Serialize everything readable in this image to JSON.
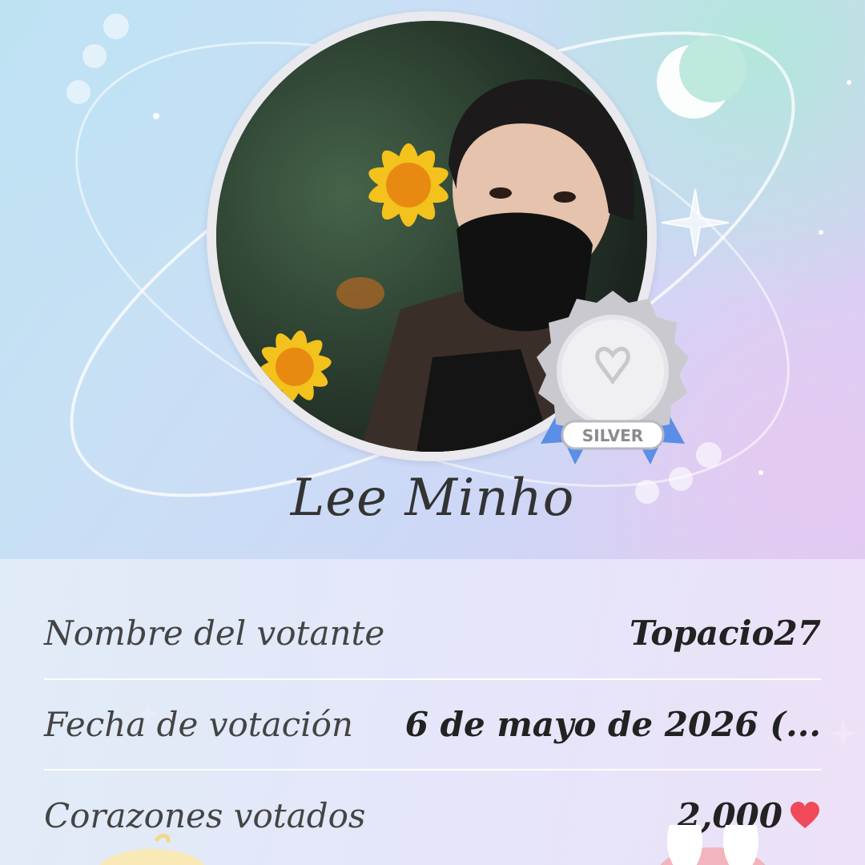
{
  "artist": {
    "name": "Lee Minho",
    "photo_description_icon": "profile-photo"
  },
  "badge": {
    "tier_label": "SILVER",
    "icon": "medal-icon"
  },
  "details": [
    {
      "label": "Nombre del votante",
      "value": "Topacio27"
    },
    {
      "label": "Fecha de votación",
      "value": "6 de mayo de 2026 (..."
    },
    {
      "label": "Corazones votados",
      "value": "2,000",
      "icon": "heart-icon"
    }
  ],
  "colors": {
    "heart": "#f04a5a",
    "badge_ribbon": "#5b8ee6",
    "badge_silver": "#c9c9cf"
  }
}
